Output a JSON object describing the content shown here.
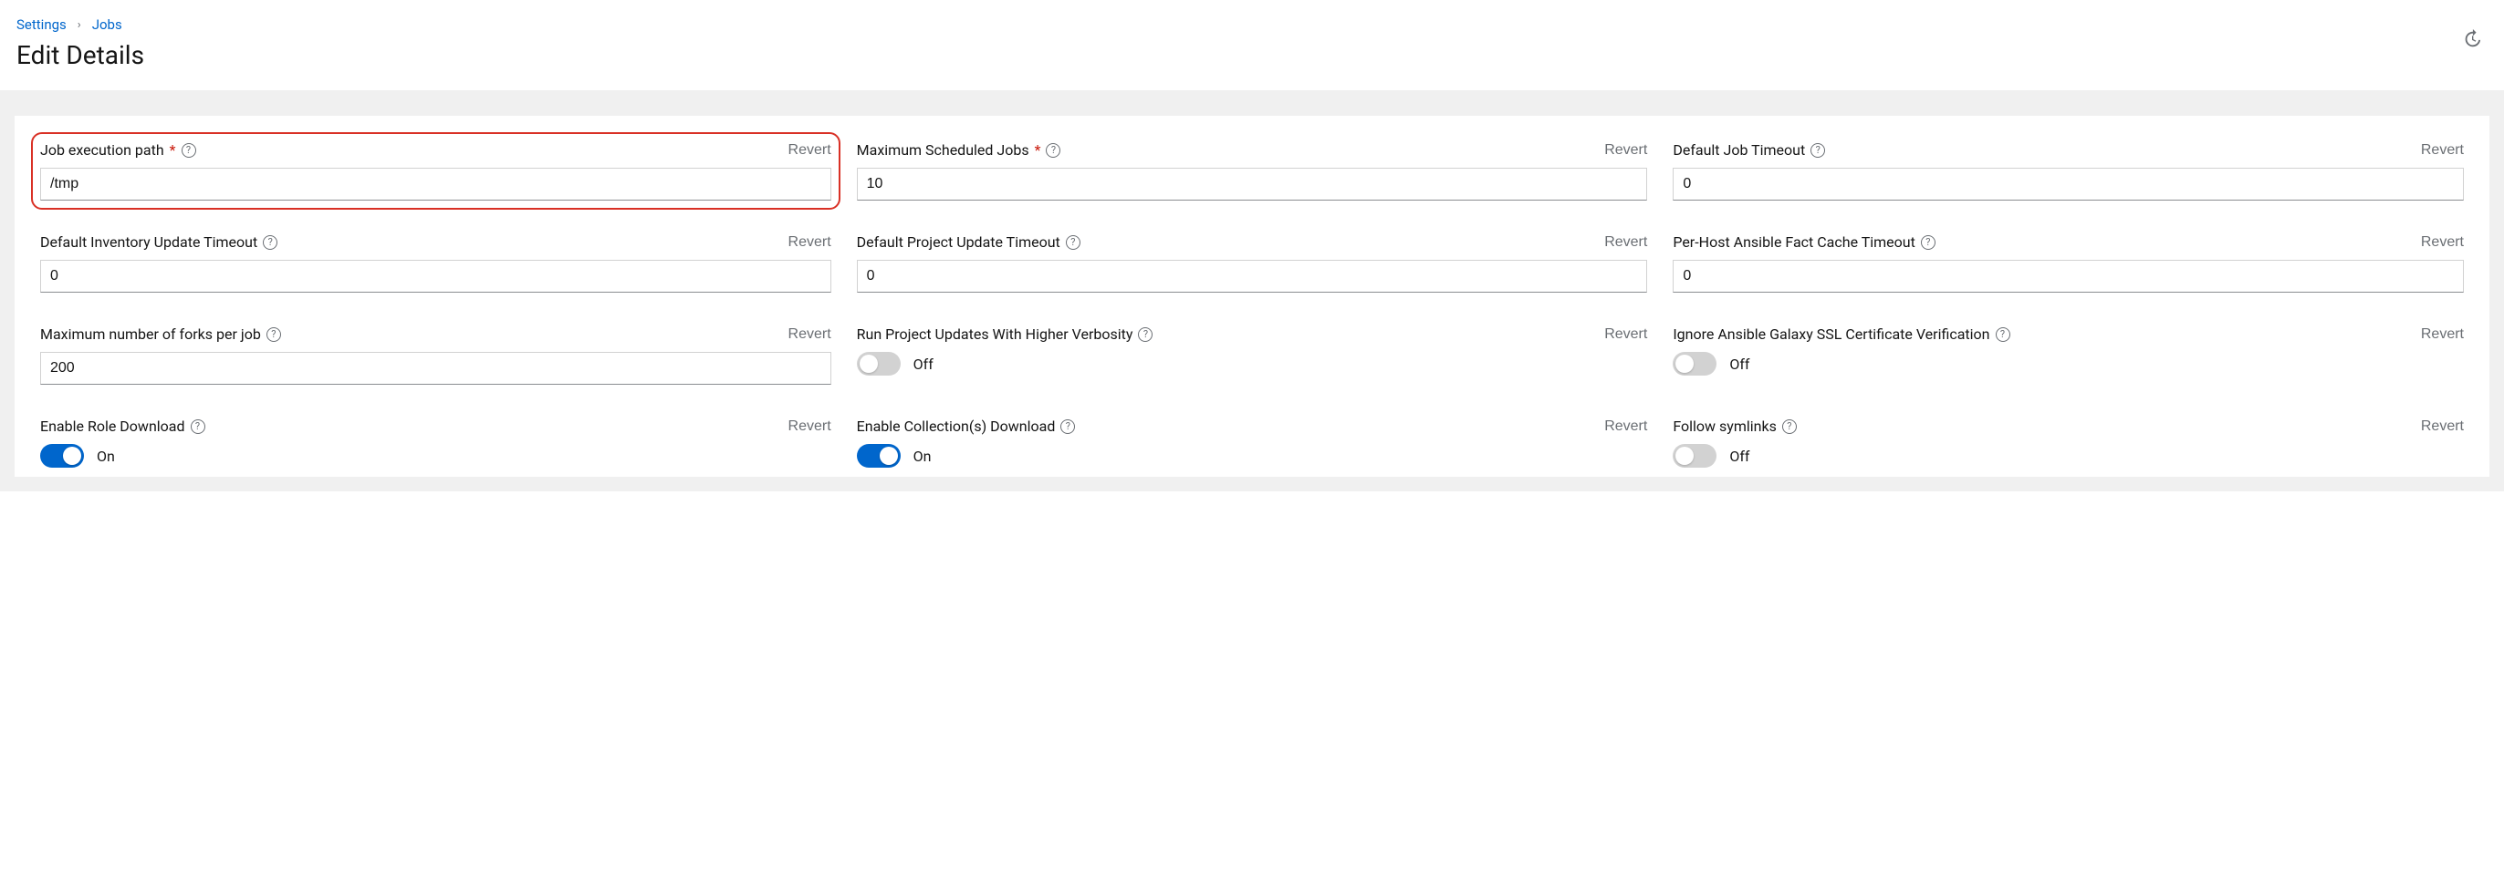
{
  "breadcrumb": {
    "settings": "Settings",
    "jobs": "Jobs"
  },
  "page_title": "Edit Details",
  "revert_label": "Revert",
  "toggle_on": "On",
  "toggle_off": "Off",
  "fields": {
    "job_exec_path": {
      "label": "Job execution path",
      "required": true,
      "value": "/tmp"
    },
    "max_scheduled": {
      "label": "Maximum Scheduled Jobs",
      "required": true,
      "value": "10"
    },
    "default_job_timeout": {
      "label": "Default Job Timeout",
      "required": false,
      "value": "0"
    },
    "default_inv_timeout": {
      "label": "Default Inventory Update Timeout",
      "required": false,
      "value": "0"
    },
    "default_proj_timeout": {
      "label": "Default Project Update Timeout",
      "required": false,
      "value": "0"
    },
    "fact_cache_timeout": {
      "label": "Per-Host Ansible Fact Cache Timeout",
      "required": false,
      "value": "0"
    },
    "max_forks": {
      "label": "Maximum number of forks per job",
      "required": false,
      "value": "200"
    },
    "higher_verbosity": {
      "label": "Run Project Updates With Higher Verbosity",
      "required": false,
      "on": false
    },
    "ignore_ssl": {
      "label": "Ignore Ansible Galaxy SSL Certificate Verification",
      "required": false,
      "on": false
    },
    "enable_role_dl": {
      "label": "Enable Role Download",
      "required": false,
      "on": true
    },
    "enable_collection_dl": {
      "label": "Enable Collection(s) Download",
      "required": false,
      "on": true
    },
    "follow_symlinks": {
      "label": "Follow symlinks",
      "required": false,
      "on": false
    }
  }
}
